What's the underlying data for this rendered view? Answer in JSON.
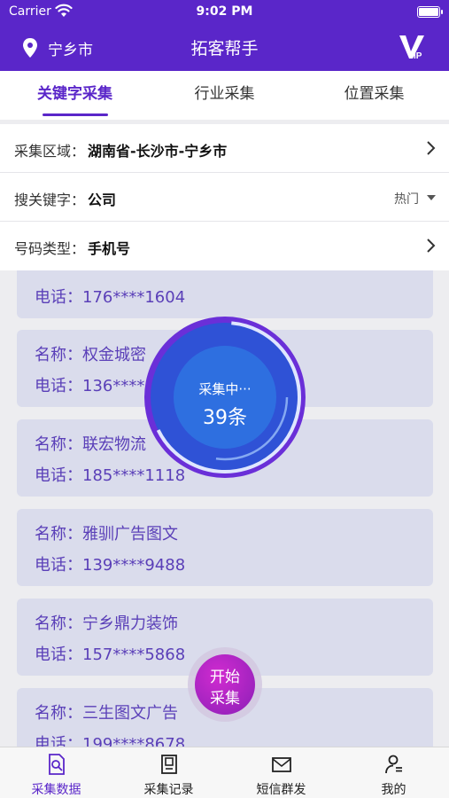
{
  "status_bar": {
    "carrier": "Carrier",
    "time": "9:02 PM"
  },
  "nav": {
    "location": "宁乡市",
    "title": "拓客帮手",
    "vip_icon": "vip-icon"
  },
  "tabs": [
    {
      "label": "关键字采集",
      "active": true
    },
    {
      "label": "行业采集",
      "active": false
    },
    {
      "label": "位置采集",
      "active": false
    }
  ],
  "form": {
    "region": {
      "label": "采集区域：",
      "value": "湖南省-长沙市-宁乡市"
    },
    "keyword": {
      "label": "搜关键字：",
      "value": "公司",
      "hot": "热门"
    },
    "number_type": {
      "label": "号码类型：",
      "value": "手机号"
    }
  },
  "cards": [
    {
      "name": "",
      "phone": "电话：176****1604"
    },
    {
      "name": "名称：权金城密",
      "phone": "电话：136****"
    },
    {
      "name": "名称：联宏物流",
      "phone": "电话：185****1118"
    },
    {
      "name": "名称：雅驯广告图文",
      "phone": "电话：139****9488"
    },
    {
      "name": "名称：宁乡鼎力装饰",
      "phone": "电话：157****5868"
    },
    {
      "name": "名称：三生图文广告",
      "phone": "电话：199****8678"
    }
  ],
  "progress": {
    "status": "采集中···",
    "count": "39条"
  },
  "start_button": {
    "line1": "开始",
    "line2": "采集"
  },
  "tabbar": [
    {
      "label": "采集数据",
      "icon": "document-search-icon",
      "active": true
    },
    {
      "label": "采集记录",
      "icon": "record-icon",
      "active": false
    },
    {
      "label": "短信群发",
      "icon": "mail-icon",
      "active": false
    },
    {
      "label": "我的",
      "icon": "user-icon",
      "active": false
    }
  ],
  "colors": {
    "primary": "#5a26c9",
    "card_bg": "#dadcec",
    "card_text": "#5a3fb8",
    "progress_blue": "#2e6fe0",
    "button_magenta": "#b324c9"
  }
}
